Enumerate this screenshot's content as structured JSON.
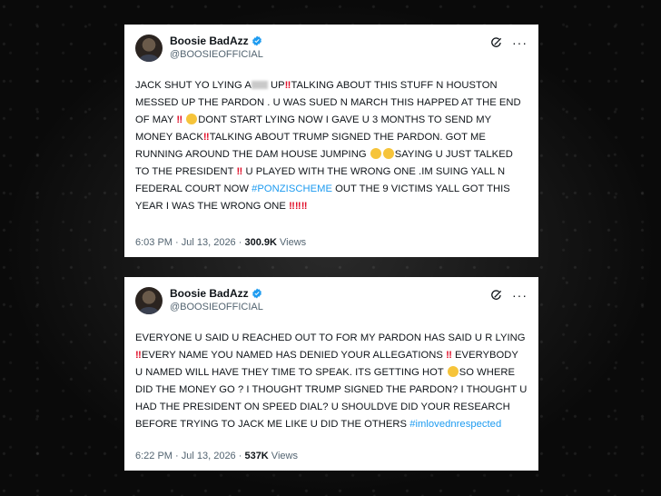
{
  "tweets": [
    {
      "name": "Boosie BadAzz",
      "handle": "@BOOSIEOFFICIAL",
      "text_parts": {
        "p1": "JACK SHUT YO LYING A",
        "p2": " UP",
        "p3": "TALKING ABOUT THIS STUFF N HOUSTON MESSED UP THE PARDON . U WAS SUED N MARCH THIS HAPPED AT THE END OF MAY ",
        "p4": "DONT START LYING NOW I GAVE U 3 MONTHS TO SEND MY MONEY BACK",
        "p5": "TALKING ABOUT TRUMP SIGNED THE PARDON. GOT ME RUNNING AROUND THE DAM HOUSE JUMPING ",
        "p6": "SAYING U JUST TALKED TO THE PRESIDENT ",
        "p7": " U PLAYED WITH THE WRONG ONE .IM SUING YALL N FEDERAL COURT NOW ",
        "hashtag": "#PONZISCHEME",
        "p8": " OUT THE 9 VICTIMS YALL GOT THIS YEAR I WAS THE WRONG ONE "
      },
      "time": "6:03 PM · Jul 13, 2026 · ",
      "views_count": "300.9K",
      "views_label": " Views"
    },
    {
      "name": "Boosie BadAzz",
      "handle": "@BOOSIEOFFICIAL",
      "text_parts": {
        "p1": "EVERYONE U SAID U REACHED OUT TO FOR MY PARDON HAS SAID U R LYING ",
        "p2": "EVERY NAME YOU NAMED HAS DENIED YOUR ALLEGATIONS ",
        "p3": " EVERYBODY U NAMED WILL HAVE THEY TIME TO SPEAK. ITS GETTING HOT ",
        "p4": "SO WHERE DID THE MONEY GO ? I THOUGHT TRUMP SIGNED THE PARDON? I THOUGHT U HAD THE PRESIDENT ON SPEED DIAL? U SHOULDVE DID YOUR RESEARCH BEFORE TRYING TO JACK ME LIKE U DID THE OTHERS ",
        "hashtag": "#imlovednrespected"
      },
      "time": "6:22 PM · Jul 13, 2026 · ",
      "views_count": "537K",
      "views_label": " Views"
    }
  ],
  "emoji": {
    "double_bang": "‼️",
    "bang_char": "‼"
  },
  "colors": {
    "background": "#0d0d0d",
    "card": "#ffffff",
    "text": "#0f1419",
    "muted": "#536471",
    "link": "#1d9bf0",
    "verified": "#1d9bf0",
    "emoji_red": "#e0102a"
  },
  "icons": [
    "verified-badge-icon",
    "grok-icon",
    "more-icon",
    "avatar"
  ]
}
